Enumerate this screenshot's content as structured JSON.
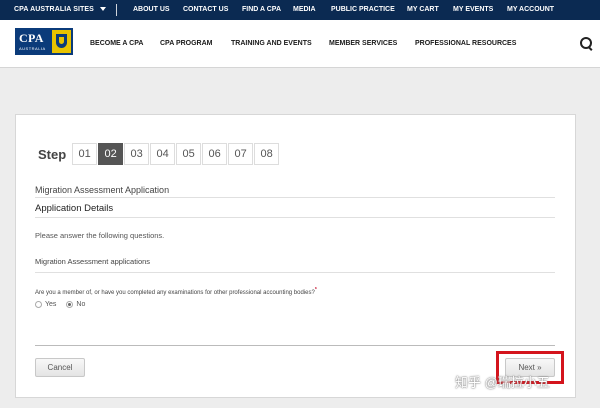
{
  "topbar": {
    "sites": "CPA AUSTRALIA SITES",
    "links": [
      "ABOUT US",
      "CONTACT US",
      "FIND A CPA",
      "MEDIA",
      "PUBLIC PRACTICE",
      "MY CART",
      "MY EVENTS",
      "MY ACCOUNT"
    ]
  },
  "logo": {
    "text": "CPA",
    "sub": "AUSTRALIA"
  },
  "nav": {
    "links": [
      "BECOME A CPA",
      "CPA PROGRAM",
      "TRAINING AND EVENTS",
      "MEMBER SERVICES",
      "PROFESSIONAL RESOURCES"
    ]
  },
  "form": {
    "step_label": "Step",
    "steps": [
      "01",
      "02",
      "03",
      "04",
      "05",
      "06",
      "07",
      "08"
    ],
    "active_step": "02",
    "form_title": "Migration Assessment Application",
    "section_title": "Application Details",
    "instructions": "Please answer the following questions.",
    "subsection": "Migration Assessment applications",
    "question": "Are you a member of, or have you completed any examinations for other professional accounting bodies?",
    "required_mark": "*",
    "options": [
      "Yes",
      "No"
    ],
    "selected_option": "No",
    "cancel_label": "Cancel",
    "next_label": "Next »"
  },
  "watermark": "知乎 @瑞拉小五",
  "colors": {
    "topbar": "#0b2a52",
    "logo": "#0b3b7a",
    "crest": "#e8c300",
    "highlight": "#d4141c",
    "required": "#c8102e"
  }
}
